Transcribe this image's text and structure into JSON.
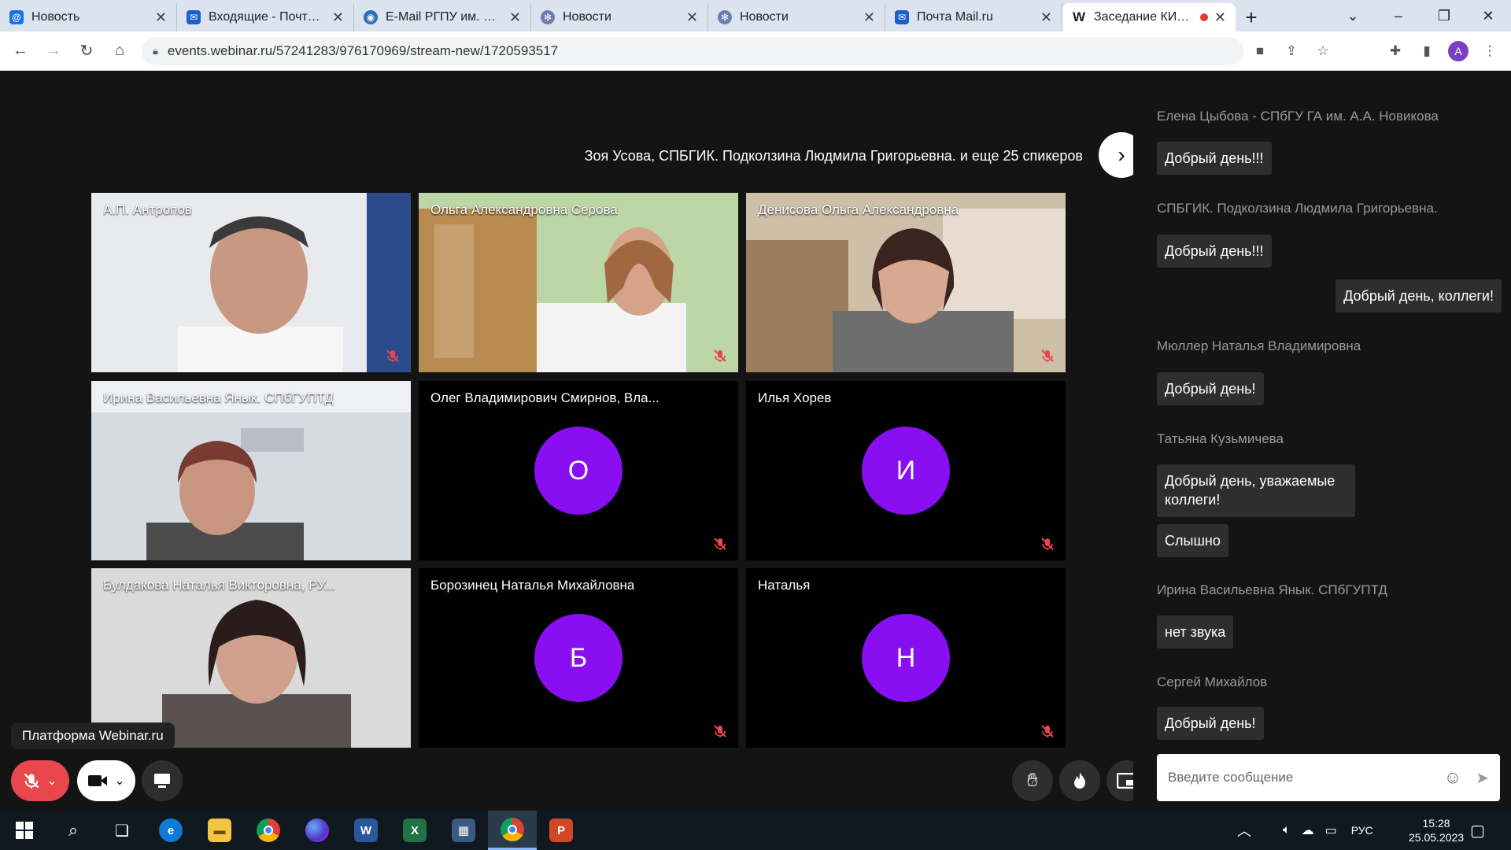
{
  "browser": {
    "tabs": [
      {
        "label": "Новость",
        "icon": "mail-at-icon"
      },
      {
        "label": "Входящие - Почта Mail.ru",
        "icon": "mail-envelope-icon"
      },
      {
        "label": "E-Mail РГПУ им. А. И. Герцена",
        "icon": "globe-mail-icon"
      },
      {
        "label": "Новости",
        "icon": "gear-icon"
      },
      {
        "label": "Новости",
        "icon": "gear-icon"
      },
      {
        "label": "Почта Mail.ru",
        "icon": "mail-envelope-icon"
      },
      {
        "label": "Заседание КИО СЗ",
        "icon": "webinar-w-icon",
        "active": true,
        "recording": true
      }
    ],
    "url": "events.webinar.ru/57241283/976170969/stream-new/1720593517",
    "profile_initial": "A"
  },
  "stream": {
    "speakers_line": "Зоя Усова, СПБГИК. Подколзина Людмила Григорьевна. и еще 25 спикеров",
    "tiles": [
      {
        "name": "А.П. Антропов",
        "video": true,
        "muted": true
      },
      {
        "name": "Ольга Александровна Серова",
        "video": true,
        "muted": true
      },
      {
        "name": "Денисова Ольга Александровна",
        "video": true,
        "muted": true
      },
      {
        "name": "Ирина Васильевна Янык. СПбГУПТД",
        "video": true,
        "muted": false,
        "highlighted": true
      },
      {
        "name": "Олег Владимирович Смирнов, Вла...",
        "video": false,
        "avatar": "О",
        "muted": true
      },
      {
        "name": "Илья Хорев",
        "video": false,
        "avatar": "И",
        "muted": true
      },
      {
        "name": "Булдакова Наталья Викторовна, РУ...",
        "video": true,
        "muted": false
      },
      {
        "name": "Борозинец Наталья Михайловна",
        "video": false,
        "avatar": "Б",
        "muted": true
      },
      {
        "name": "Наталья",
        "video": false,
        "avatar": "Н",
        "muted": true
      }
    ],
    "platform_badge": "Платформа Webinar.ru"
  },
  "chat": {
    "messages": [
      {
        "author": "Елена Цыбова - СПбГУ ГА им. А.А. Новикова",
        "texts": [
          "Добрый день!!!"
        ]
      },
      {
        "author": "СПБГИК. Подколзина Людмила Григорьевна.",
        "texts": [
          "Добрый день!!!"
        ]
      },
      {
        "author": "",
        "mine": true,
        "texts": [
          "Добрый день, коллеги!"
        ]
      },
      {
        "author": "Мюллер Наталья Владимировна",
        "texts": [
          "Добрый день!"
        ]
      },
      {
        "author": "Татьяна Кузьмичева",
        "texts": [
          "Добрый день, уважаемые коллеги!",
          "Слышно"
        ]
      },
      {
        "author": "Ирина Васильевна Янык. СПбГУПТД",
        "texts": [
          "нет звука"
        ]
      },
      {
        "author": "Сергей Михайлов",
        "texts": [
          "Добрый день!"
        ]
      }
    ],
    "input_placeholder": "Введите сообщение"
  },
  "taskbar": {
    "language": "РУС",
    "time": "15:28",
    "date": "25.05.2023"
  },
  "colors": {
    "accent": "#8a0ef2",
    "mute_red": "#e8474d",
    "highlight": "#7b2ff7"
  }
}
